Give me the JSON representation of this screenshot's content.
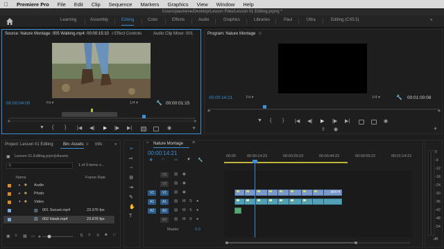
{
  "menubar": {
    "app": "Premiere Pro",
    "items": [
      "File",
      "Edit",
      "Clip",
      "Sequence",
      "Markers",
      "Graphics",
      "View",
      "Window",
      "Help"
    ]
  },
  "titlebar": {
    "path": "/Users/paulnene/Desktop/Lesson Files/Lesson 01 Editing.prproj *"
  },
  "workspaces": [
    "Learning",
    "Assembly",
    "Editing",
    "Color",
    "Effects",
    "Audio",
    "Graphics",
    "Libraries",
    "Paul",
    "Ultra",
    "Editing (CS5.5)"
  ],
  "active_workspace": "Editing",
  "source": {
    "tabs": [
      "Source: Nature Montage: 005 Walking.mp4: 00:00:15:10",
      "Effect Controls",
      "Audio Clip Mixer: 001"
    ],
    "timecode": "00:00:04:00",
    "fit": "Fit",
    "res": "1/4",
    "duration": "00:00:01:15"
  },
  "program": {
    "tab": "Program: Nature Montage",
    "timecode": "00:00:14:21",
    "fit": "Fit",
    "res": "1/4",
    "duration": "00:01:00:08"
  },
  "project": {
    "tabs": [
      "Project: Lesson 01 Editing",
      "Bin: Assets",
      "Info"
    ],
    "path": "Lesson 01 Editing.prproj\\Assets",
    "count": "1 of 9 items s...",
    "col_name": "Name",
    "col_rate": "Frame Rate",
    "items": [
      {
        "name": "Audio",
        "rate": "",
        "type": "folder",
        "color": "#d98b2b"
      },
      {
        "name": "Photo",
        "rate": "",
        "type": "folder",
        "color": "#d98b2b"
      },
      {
        "name": "Video",
        "rate": "",
        "type": "folder",
        "color": "#d98b2b"
      },
      {
        "name": "001 Sunset.mp4",
        "rate": "23.976 fps",
        "type": "clip",
        "color": "#7aa6d9"
      },
      {
        "name": "002 Hawk.mp4",
        "rate": "23.976 fps",
        "type": "clip",
        "color": "#7aa6d9"
      }
    ]
  },
  "timeline": {
    "tab": "Nature Montage",
    "timecode": "00:00:14:21",
    "ruler": [
      "00:00",
      "00:00:14:23",
      "00:00:29:23",
      "00:00:44:22",
      "00:00:59:22",
      "00:01:14:22"
    ],
    "tracks": [
      {
        "name": "V3",
        "kind": "video"
      },
      {
        "name": "V2",
        "kind": "video"
      },
      {
        "name": "V1",
        "kind": "video"
      },
      {
        "name": "A1",
        "kind": "audio"
      },
      {
        "name": "A2",
        "kind": "audio"
      },
      {
        "name": "A3",
        "kind": "audio"
      }
    ],
    "master_label": "Master",
    "master_value": "0.0",
    "clip_label": "004 H"
  },
  "meter": [
    "0",
    "-6",
    "-12",
    "-18",
    "-24",
    "-30",
    "-36",
    "-42",
    "-48",
    "-54",
    "dB"
  ],
  "colors": {
    "accent": "#3d8fd6",
    "panel_bg": "#1e1e1e"
  }
}
